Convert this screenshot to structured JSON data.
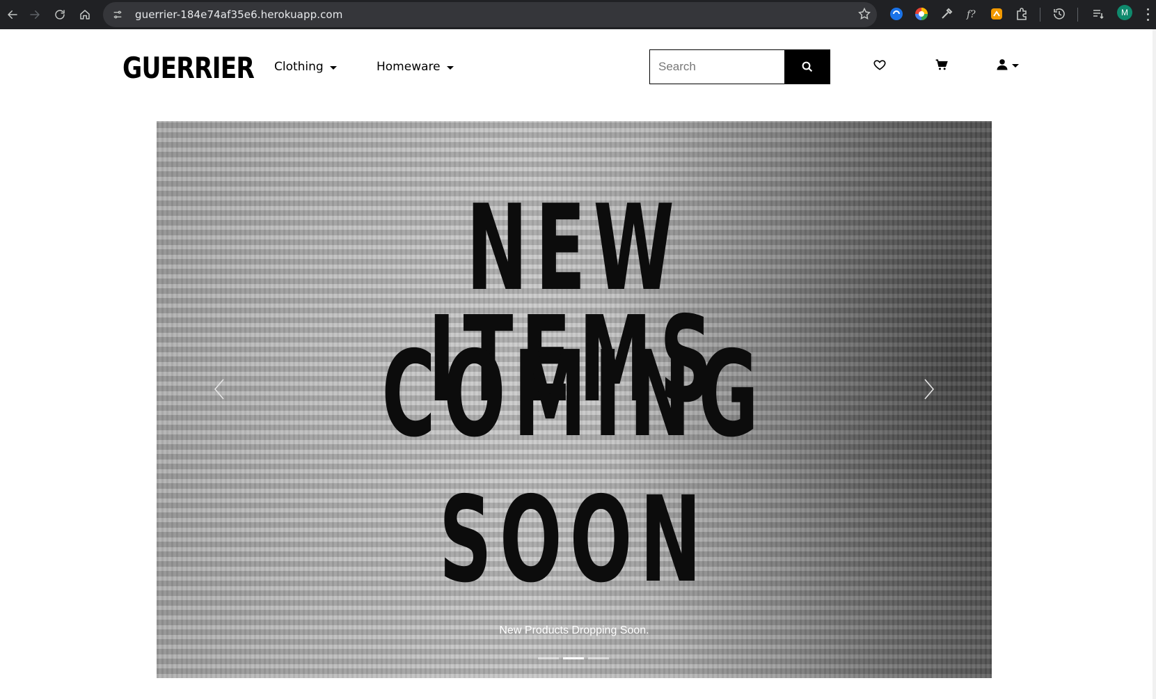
{
  "browser": {
    "url": "guerrier-184e74af35e6.herokuapp.com",
    "profile_initial": "M"
  },
  "header": {
    "logo": "GUERRIER",
    "menus": [
      {
        "label": "Clothing"
      },
      {
        "label": "Homeware"
      }
    ],
    "search": {
      "placeholder": "Search",
      "value": ""
    }
  },
  "carousel": {
    "headline_lines": [
      "NEW ITEMS",
      "COMING",
      "SOON"
    ],
    "caption": "New Products Dropping Soon.",
    "slide_count": 3,
    "active_index": 1
  },
  "colors": {
    "chrome_bg": "#202124",
    "omnibox_bg": "#35363a",
    "brand_text": "#000000",
    "search_button": "#000000",
    "avatar_bg": "#0f8a6d"
  }
}
